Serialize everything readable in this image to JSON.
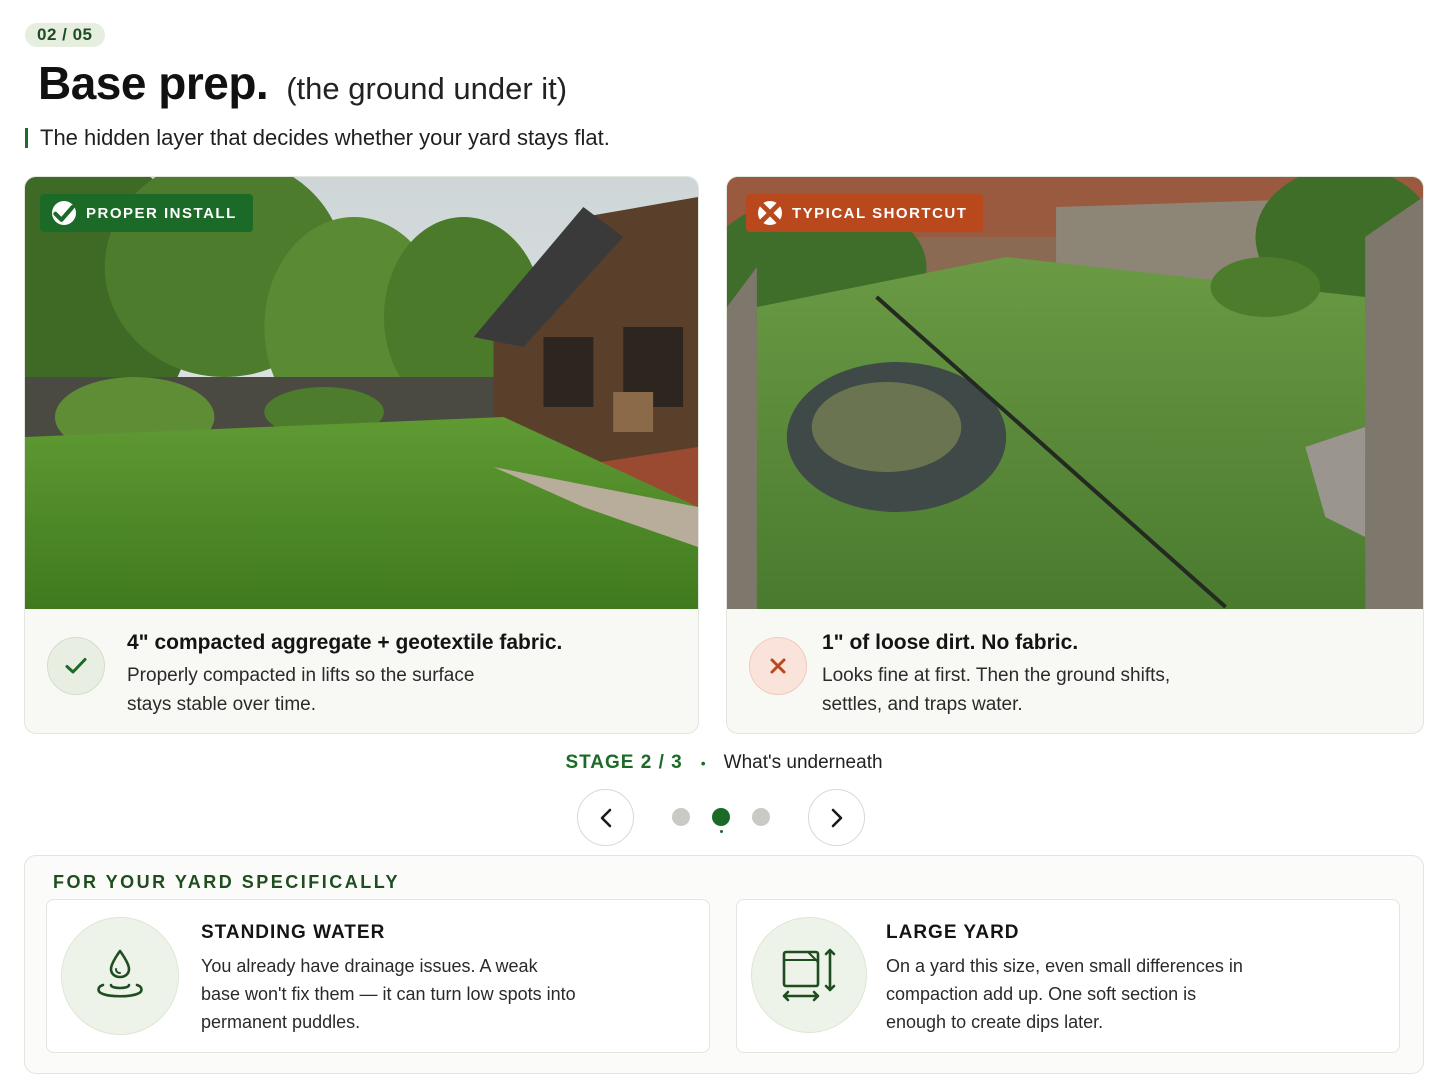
{
  "header": {
    "step": "02 / 05",
    "title": "Base prep.",
    "subtitle": "(the ground under it)",
    "lede": "The hidden layer that decides whether your yard stays flat."
  },
  "comparison": {
    "proper": {
      "tag": "PROPER INSTALL",
      "icon": "check-icon",
      "title": "4\" compacted aggregate + geotextile fabric.",
      "body": "Properly compacted in lifts so the surface stays stable over time."
    },
    "shortcut": {
      "tag": "TYPICAL SHORTCUT",
      "icon": "x-icon",
      "title": "1\" of loose dirt. No fabric.",
      "body": "Looks fine at first. Then the ground shifts, settles, and traps water."
    }
  },
  "stage": {
    "label": "STAGE 2 / 3",
    "separator": "•",
    "name": "What's underneath",
    "total": 3,
    "current": 2
  },
  "yard": {
    "heading": "FOR YOUR YARD SPECIFICALLY",
    "items": [
      {
        "icon": "water-drop-icon",
        "title": "STANDING WATER",
        "body": "You already have drainage issues. A weak base won't fix them — it can turn low spots into permanent puddles."
      },
      {
        "icon": "area-measure-icon",
        "title": "LARGE YARD",
        "body": "On a yard this size, even small differences in compaction add up. One soft section is enough to create dips later."
      }
    ]
  },
  "colors": {
    "brand_green": "#1b6a27",
    "warning_orange": "#b9481c",
    "pill_bg": "#e6eee0"
  }
}
